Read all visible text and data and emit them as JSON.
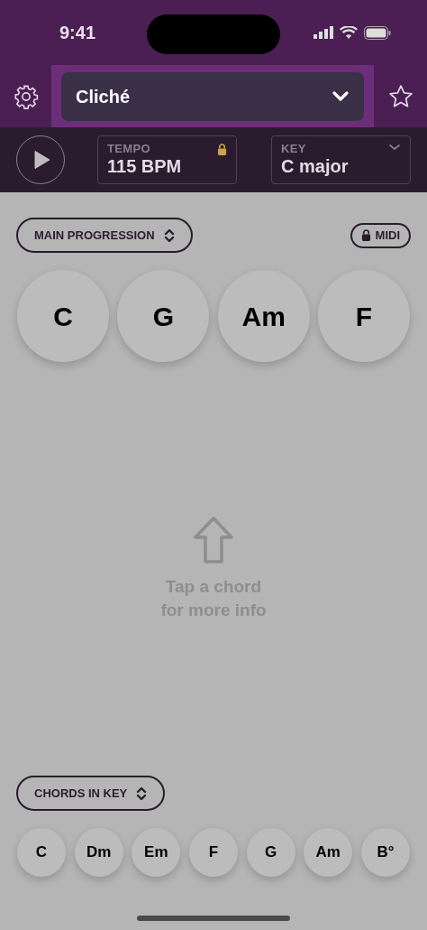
{
  "status_bar": {
    "time": "9:41"
  },
  "header": {
    "song_title": "Cliché"
  },
  "toolbar": {
    "tempo": {
      "label": "TEMPO",
      "value": "115 BPM",
      "locked": true
    },
    "key": {
      "label": "KEY",
      "value": "C major"
    }
  },
  "progression": {
    "label": "MAIN PROGRESSION",
    "midi": {
      "label": "MIDI",
      "locked": true
    },
    "chords": [
      "C",
      "G",
      "Am",
      "F"
    ]
  },
  "hint": [
    "Tap a chord",
    "for more info"
  ],
  "chords_in_key": {
    "label": "CHORDS IN KEY",
    "chords": [
      "C",
      "Dm",
      "Em",
      "F",
      "G",
      "Am",
      "B°"
    ]
  }
}
